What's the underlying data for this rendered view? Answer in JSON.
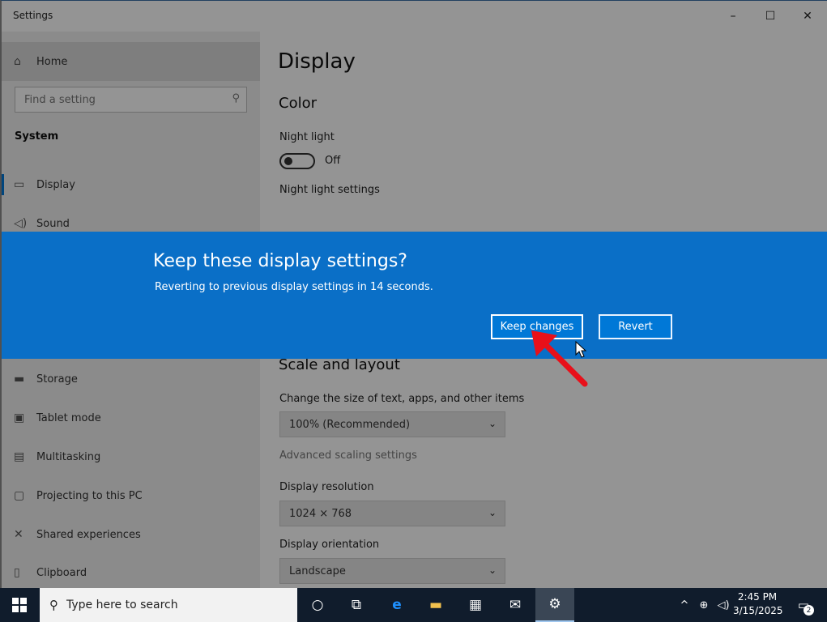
{
  "window": {
    "title": "Settings",
    "controls": {
      "minimize": "–",
      "maximize": "☐",
      "close": "✕"
    }
  },
  "sidebar": {
    "home": {
      "label": "Home",
      "icon": "home-icon"
    },
    "search": {
      "placeholder": "Find a setting"
    },
    "section": "System",
    "items": [
      {
        "label": "Display",
        "icon": "monitor-icon",
        "selected": true
      },
      {
        "label": "Sound",
        "icon": "speaker-icon"
      },
      {
        "label": "Storage",
        "icon": "storage-icon"
      },
      {
        "label": "Tablet mode",
        "icon": "tablet-icon"
      },
      {
        "label": "Multitasking",
        "icon": "multitasking-icon"
      },
      {
        "label": "Projecting to this PC",
        "icon": "project-icon"
      },
      {
        "label": "Shared experiences",
        "icon": "shared-icon"
      },
      {
        "label": "Clipboard",
        "icon": "clipboard-icon"
      }
    ]
  },
  "content": {
    "title": "Display",
    "color_heading": "Color",
    "night_light_label": "Night light",
    "night_light_state": "Off",
    "night_light_settings": "Night light settings",
    "scale_heading": "Scale and layout",
    "scale_label": "Change the size of text, apps, and other items",
    "scale_value": "100% (Recommended)",
    "advanced_scaling": "Advanced scaling settings",
    "resolution_label": "Display resolution",
    "resolution_value": "1024 × 768",
    "orientation_label": "Display orientation",
    "orientation_value": "Landscape"
  },
  "dialog": {
    "title": "Keep these display settings?",
    "message": "Reverting to previous display settings in 14 seconds.",
    "keep_label": "Keep changes",
    "revert_label": "Revert"
  },
  "taskbar": {
    "search_text": "Type here to search",
    "apps": [
      "cortana-icon",
      "task-view-icon",
      "edge-icon",
      "file-explorer-icon",
      "store-icon",
      "mail-icon",
      "settings-icon"
    ],
    "time": "2:45 PM",
    "date": "3/15/2025",
    "notification_count": "2"
  },
  "colors": {
    "accent": "#0078d7",
    "dialog_bg": "#0a6fc7",
    "taskbar": "#101c2c",
    "annotation_arrow": "#e8101a"
  }
}
